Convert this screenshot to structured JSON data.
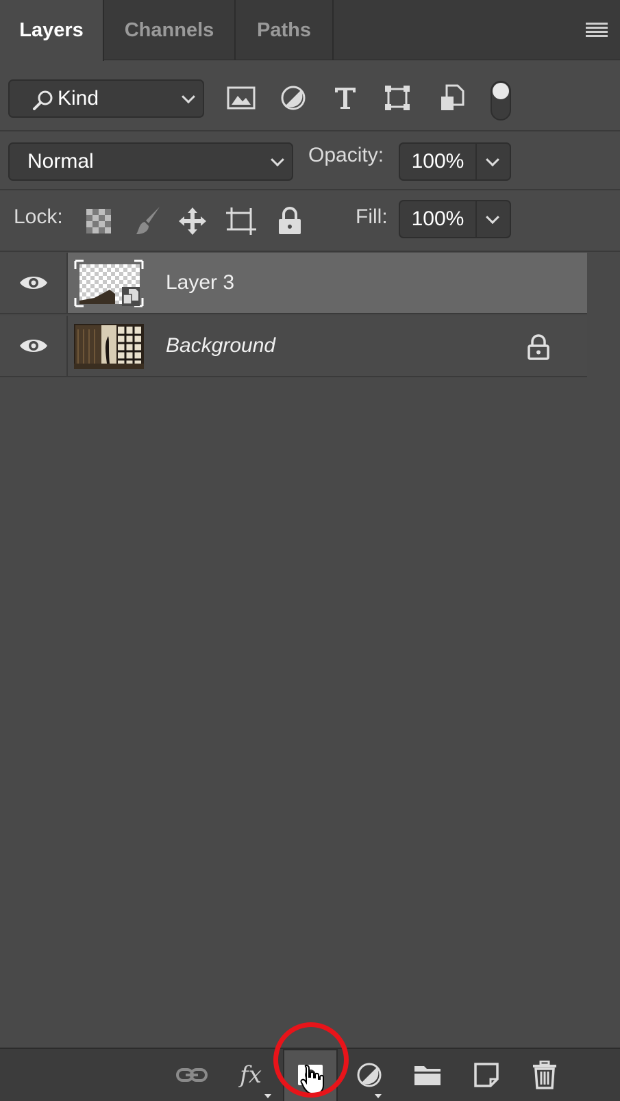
{
  "tabs": [
    {
      "label": "Layers",
      "active": true
    },
    {
      "label": "Channels",
      "active": false
    },
    {
      "label": "Paths",
      "active": false
    }
  ],
  "filter": {
    "kind_label": "Kind",
    "icons": [
      "image-filter-icon",
      "adjustment-filter-icon",
      "type-filter-icon",
      "shape-filter-icon",
      "smart-object-filter-icon"
    ],
    "toggle_icon": "filter-toggle-icon"
  },
  "blend": {
    "mode": "Normal",
    "opacity_label": "Opacity:",
    "opacity_value": "100%"
  },
  "lock": {
    "label": "Lock:",
    "icons": [
      "lock-transparent-pixels-icon",
      "lock-image-pixels-icon",
      "lock-position-icon",
      "lock-artboard-icon",
      "lock-all-icon"
    ],
    "fill_label": "Fill:",
    "fill_value": "100%"
  },
  "layers": [
    {
      "name": "Layer 3",
      "selected": true,
      "italic": false,
      "visible": true,
      "locked": false,
      "thumbnail": "smart-object-transparent"
    },
    {
      "name": "Background",
      "selected": false,
      "italic": true,
      "visible": true,
      "locked": true,
      "thumbnail": "photo"
    }
  ],
  "bottom_icons": [
    "link-layers-icon",
    "fx-icon",
    "add-mask-icon",
    "adjustment-layer-icon",
    "group-folder-icon",
    "new-layer-icon",
    "trash-icon"
  ],
  "fx_label": "fx",
  "highlight": {
    "target": "add-mask-icon",
    "color": "#e8141a"
  },
  "colors": {
    "panel": "#4a4a4a",
    "selected_row": "#676767",
    "tabbar": "#3a3a3a"
  }
}
